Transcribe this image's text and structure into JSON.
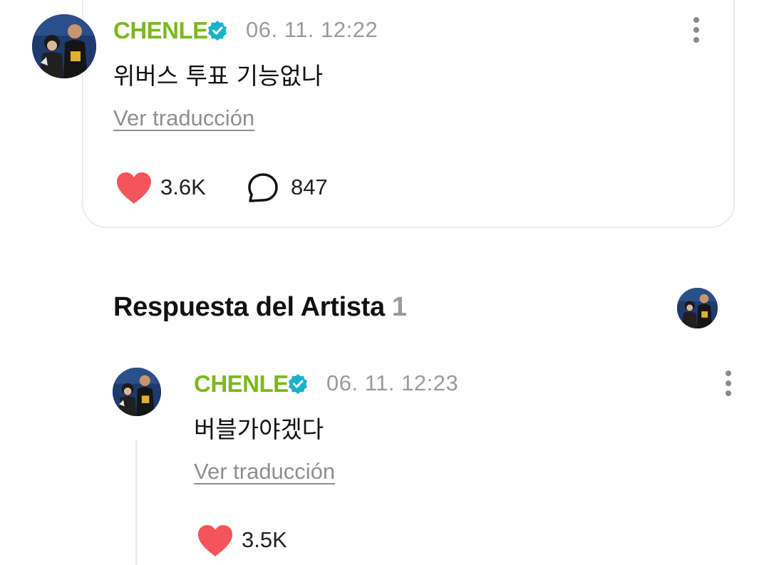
{
  "post": {
    "author": "CHENLE",
    "timestamp": "06. 11. 12:22",
    "text": "위버스 투표 기능없나",
    "translate_label": "Ver traducción",
    "likes": "3.6K",
    "comments": "847"
  },
  "artist_reply_section": {
    "title": "Respuesta del Artista",
    "count": "1"
  },
  "reply": {
    "author": "CHENLE",
    "timestamp": "06. 11. 12:23",
    "text": "버블가야겠다",
    "translate_label": "Ver traducción",
    "likes": "3.5K"
  },
  "colors": {
    "author_name": "#7cb81c",
    "verified_badge": "#1ab1c9",
    "heart": "#f4545c",
    "timestamp": "#9b9b9b"
  },
  "icons": [
    "verified-badge-icon",
    "more-vertical-icon",
    "heart-icon",
    "comment-bubble-icon"
  ]
}
